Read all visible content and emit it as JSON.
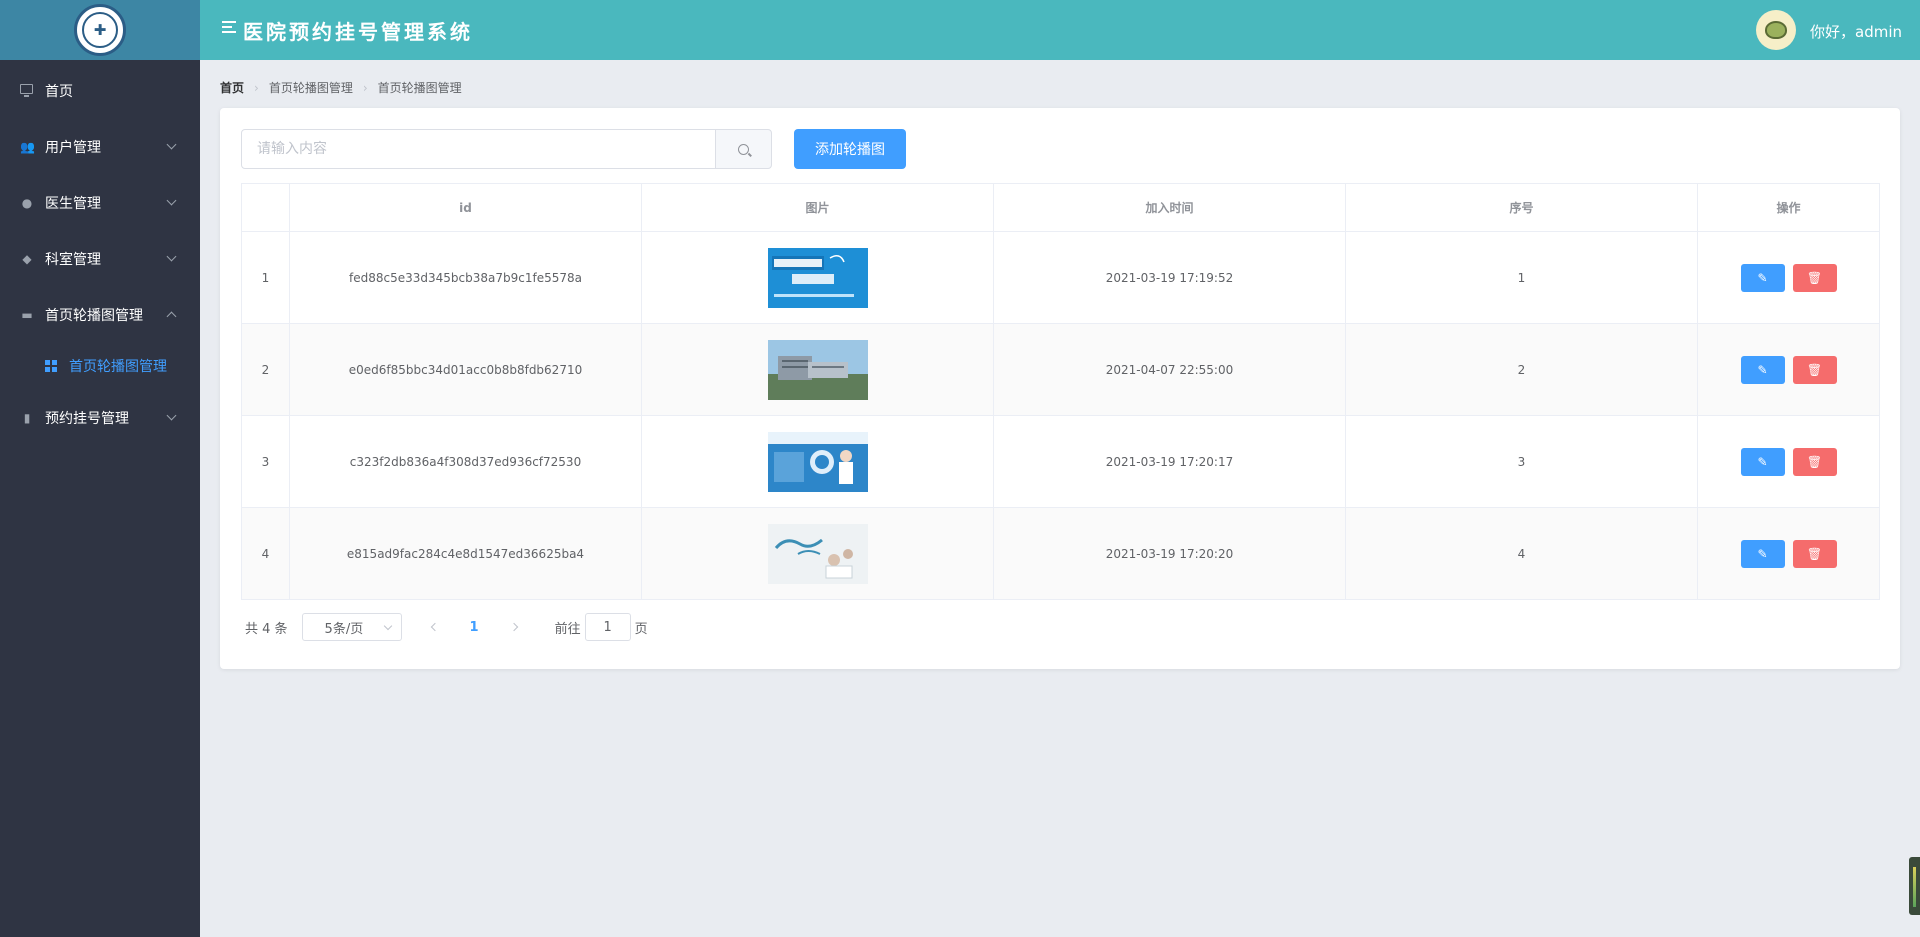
{
  "header": {
    "title": "医院预约挂号管理系统",
    "greeting": "你好，admin",
    "brand_color": "#4ab8be",
    "logo_color": "#3d86a4"
  },
  "sidebar": {
    "items": [
      {
        "label": "首页",
        "icon": "monitor-icon"
      },
      {
        "label": "用户管理",
        "icon": "users-icon"
      },
      {
        "label": "医生管理",
        "icon": "user-icon"
      },
      {
        "label": "科室管理",
        "icon": "box-icon"
      },
      {
        "label": "首页轮播图管理",
        "icon": "slides-icon",
        "expanded": true
      },
      {
        "label": "预约挂号管理",
        "icon": "clipboard-icon"
      }
    ],
    "active_sub": {
      "label": "首页轮播图管理",
      "icon": "grid-icon"
    }
  },
  "breadcrumb": [
    "首页",
    "首页轮播图管理",
    "首页轮播图管理"
  ],
  "search": {
    "placeholder": "请输入内容",
    "value": ""
  },
  "add_button": "添加轮播图",
  "table": {
    "columns": [
      "",
      "id",
      "图片",
      "加入时间",
      "序号",
      "操作"
    ],
    "rows": [
      {
        "index": "1",
        "id": "fed88c5e33d345bcb38a7b9c1fe5578a",
        "image": "banner-appointment",
        "time": "2021-03-19 17:19:52",
        "order": "1"
      },
      {
        "index": "2",
        "id": "e0ed6f85bbc34d01acc0b8b8fdb62710",
        "image": "banner-hospital-building",
        "time": "2021-04-07 22:55:00",
        "order": "2"
      },
      {
        "index": "3",
        "id": "c323f2db836a4f308d37ed936cf72530",
        "image": "banner-doctor",
        "time": "2021-03-19 17:20:17",
        "order": "3"
      },
      {
        "index": "4",
        "id": "e815ad9fac284c4e8d1547ed36625ba4",
        "image": "banner-health",
        "time": "2021-03-19 17:20:20",
        "order": "4"
      }
    ]
  },
  "pagination": {
    "total": "共 4 条",
    "page_size": "5条/页",
    "current": "1",
    "goto_prefix": "前往",
    "goto_value": "1",
    "goto_suffix": "页"
  },
  "colors": {
    "primary": "#409eff",
    "danger": "#f56c6c",
    "sidebar": "#2f3443"
  }
}
